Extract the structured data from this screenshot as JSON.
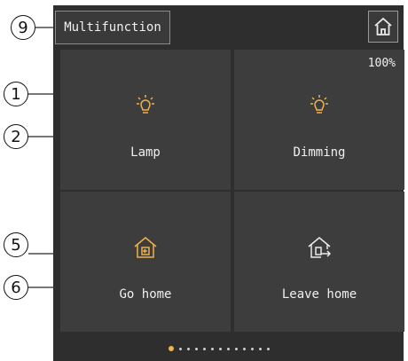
{
  "header": {
    "title": "Multifunction"
  },
  "tiles": [
    {
      "label": "Lamp",
      "icon": "lamp-icon",
      "value": ""
    },
    {
      "label": "Dimming",
      "icon": "lamp-icon",
      "value": "100%"
    },
    {
      "label": "Go home",
      "icon": "go-home-icon",
      "value": ""
    },
    {
      "label": "Leave home",
      "icon": "leave-home-icon",
      "value": ""
    }
  ],
  "callouts": {
    "c1": "1",
    "c2": "2",
    "c5": "5",
    "c6": "6",
    "c9": "9"
  },
  "pager": {
    "active_index": 0,
    "count": 13
  },
  "colors": {
    "panel": "#2e2e2e",
    "tile": "#3d3d3d",
    "accent": "#f1b24a"
  }
}
